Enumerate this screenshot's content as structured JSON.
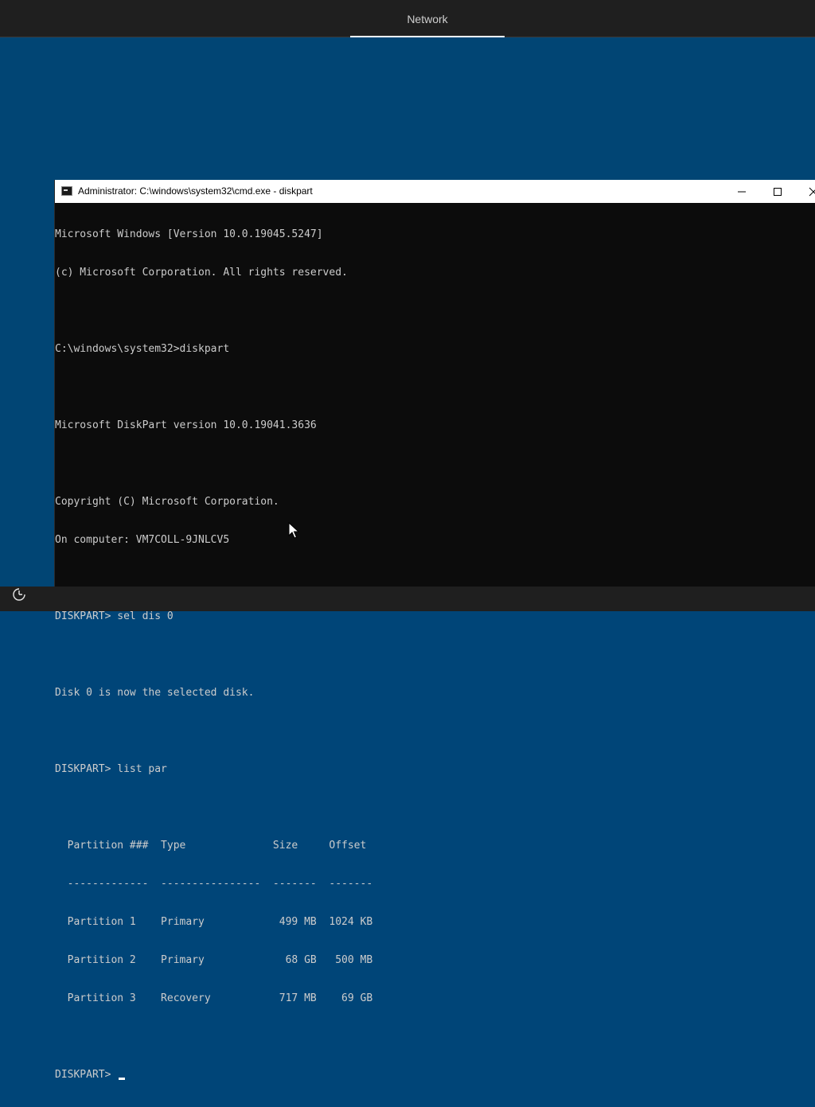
{
  "topbar": {
    "tab_label": "Network"
  },
  "window": {
    "title": "Administrator: C:\\windows\\system32\\cmd.exe - diskpart"
  },
  "console": {
    "lines": [
      "Microsoft Windows [Version 10.0.19045.5247]",
      "(c) Microsoft Corporation. All rights reserved.",
      "",
      "C:\\windows\\system32>diskpart",
      "",
      "Microsoft DiskPart version 10.0.19041.3636",
      "",
      "Copyright (C) Microsoft Corporation.",
      "On computer: VM7COLL-9JNLCV5",
      "",
      "DISKPART> sel dis 0",
      "",
      "Disk 0 is now the selected disk.",
      "",
      "DISKPART> list par",
      "",
      "  Partition ###  Type              Size     Offset",
      "  -------------  ----------------  -------  -------",
      "  Partition 1    Primary            499 MB  1024 KB",
      "  Partition 2    Primary             68 GB   500 MB",
      "  Partition 3    Recovery           717 MB    69 GB",
      ""
    ],
    "prompt": "DISKPART> "
  },
  "icons": {
    "ease_of_access": "ease-of-access-icon",
    "app": "cmd-app-icon",
    "minimize": "minimize-icon",
    "maximize": "maximize-icon",
    "close": "close-icon",
    "mouse": "mouse-pointer-icon"
  },
  "colors": {
    "background": "#004578",
    "console_bg": "#0c0c0c",
    "console_text": "#cccccc",
    "bar": "#1f1f1f"
  }
}
